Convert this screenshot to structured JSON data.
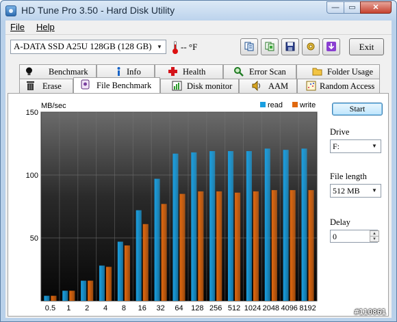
{
  "window": {
    "title": "HD Tune Pro 3.50 - Hard Disk Utility",
    "minimize_glyph": "—",
    "maximize_glyph": "▭",
    "close_glyph": "✕"
  },
  "menu": {
    "file": "File",
    "help": "Help"
  },
  "toolbar": {
    "drive_select": "A-DATA SSD A25U 128GB (128 GB)",
    "temperature": "-- °F",
    "buttons": [
      "copy-info-icon",
      "copy-screenshot-icon",
      "save-icon",
      "options-icon",
      "download-icon"
    ],
    "exit_label": "Exit"
  },
  "tabs": {
    "row1": [
      {
        "label": "Benchmark",
        "icon": "lightbulb-icon"
      },
      {
        "label": "Info",
        "icon": "info-icon"
      },
      {
        "label": "Health",
        "icon": "health-cross-icon"
      },
      {
        "label": "Error Scan",
        "icon": "magnifier-icon"
      },
      {
        "label": "Folder Usage",
        "icon": "folder-icon"
      }
    ],
    "row2": [
      {
        "label": "Erase",
        "icon": "trash-icon"
      },
      {
        "label": "File Benchmark",
        "icon": "file-benchmark-icon",
        "active": true
      },
      {
        "label": "Disk monitor",
        "icon": "chart-icon"
      },
      {
        "label": "AAM",
        "icon": "speaker-icon"
      },
      {
        "label": "Random Access",
        "icon": "random-access-icon"
      }
    ]
  },
  "controls": {
    "start_label": "Start",
    "drive_label": "Drive",
    "drive_value": "F:",
    "file_length_label": "File length",
    "file_length_value": "512 MB",
    "delay_label": "Delay",
    "delay_value": "0"
  },
  "chart_data": {
    "type": "bar",
    "ylabel": "MB/sec",
    "ylim": [
      0,
      150
    ],
    "yticks": [
      50,
      100,
      150
    ],
    "categories": [
      "0.5",
      "1",
      "2",
      "4",
      "8",
      "16",
      "32",
      "64",
      "128",
      "256",
      "512",
      "1024",
      "2048",
      "4096",
      "8192"
    ],
    "series": [
      {
        "name": "read",
        "color": "#1a9fe0",
        "values": [
          4,
          8,
          16,
          28,
          47,
          72,
          97,
          117,
          118,
          119,
          119,
          119,
          121,
          120,
          121
        ]
      },
      {
        "name": "write",
        "color": "#e0680f",
        "values": [
          4,
          8,
          16,
          27,
          44,
          61,
          77,
          85,
          87,
          87,
          86,
          87,
          88,
          88,
          88
        ]
      }
    ],
    "legend": "top-right",
    "grid": true
  },
  "watermark": "#110861"
}
